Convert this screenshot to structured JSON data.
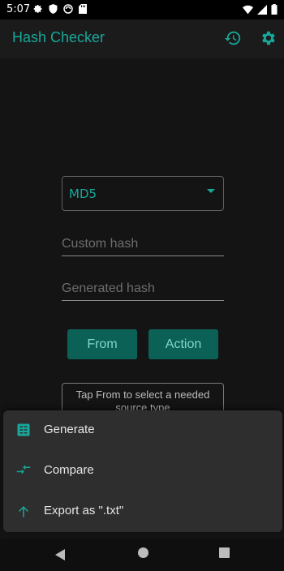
{
  "status_bar": {
    "time": "5:07",
    "left_icons": [
      "gear-icon",
      "shield-icon",
      "vpn-icon",
      "sd-card-icon"
    ],
    "right_icons": [
      "wifi-icon",
      "signal-icon",
      "battery-icon"
    ]
  },
  "app_bar": {
    "title": "Hash Checker",
    "actions": [
      "history-icon",
      "settings-icon"
    ]
  },
  "form": {
    "hash_type": "MD5",
    "custom_hash_placeholder": "Custom hash",
    "generated_hash_placeholder": "Generated hash",
    "from_button": "From",
    "action_button": "Action",
    "hint": "Tap From to select a needed source type"
  },
  "bottom_sheet": {
    "items": [
      {
        "label": "Generate",
        "icon": "generate-icon"
      },
      {
        "label": "Compare",
        "icon": "compare-icon"
      },
      {
        "label": "Export as \".txt\"",
        "icon": "export-icon"
      }
    ]
  },
  "colors": {
    "accent": "#17a89a",
    "button_bg": "#0c6157",
    "sheet_bg": "#2e2e2e",
    "background": "#141414"
  }
}
